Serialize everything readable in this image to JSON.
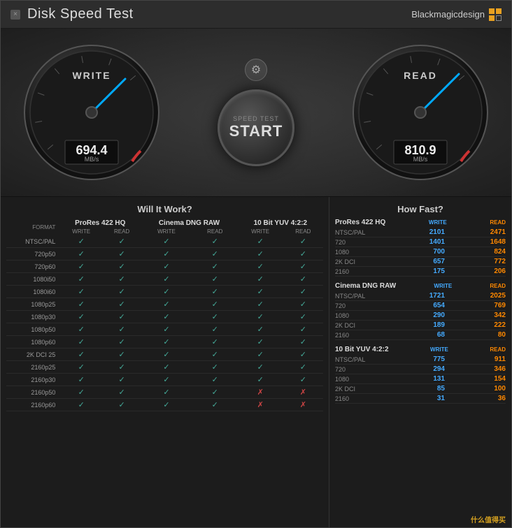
{
  "window": {
    "title": "Disk Speed Test",
    "close_label": "×"
  },
  "brand": {
    "name": "Blackmagicdesign"
  },
  "gauges": {
    "write": {
      "label": "WRITE",
      "value": "694.4",
      "unit": "MB/s"
    },
    "read": {
      "label": "READ",
      "value": "810.9",
      "unit": "MB/s"
    }
  },
  "start_button": {
    "line1": "SPEED TEST",
    "line2": "START"
  },
  "gear_icon": "⚙",
  "will_it_work": {
    "title": "Will It Work?",
    "codecs": [
      "ProRes 422 HQ",
      "Cinema DNG RAW",
      "10 Bit YUV 4:2:2"
    ],
    "col_label": "FORMAT",
    "sub_labels": [
      "WRITE",
      "READ"
    ],
    "rows": [
      {
        "format": "NTSC/PAL",
        "vals": [
          "✓",
          "✓",
          "✓",
          "✓",
          "✓",
          "✓"
        ]
      },
      {
        "format": "720p50",
        "vals": [
          "✓",
          "✓",
          "✓",
          "✓",
          "✓",
          "✓"
        ]
      },
      {
        "format": "720p60",
        "vals": [
          "✓",
          "✓",
          "✓",
          "✓",
          "✓",
          "✓"
        ]
      },
      {
        "format": "1080i50",
        "vals": [
          "✓",
          "✓",
          "✓",
          "✓",
          "✓",
          "✓"
        ]
      },
      {
        "format": "1080i60",
        "vals": [
          "✓",
          "✓",
          "✓",
          "✓",
          "✓",
          "✓"
        ]
      },
      {
        "format": "1080p25",
        "vals": [
          "✓",
          "✓",
          "✓",
          "✓",
          "✓",
          "✓"
        ]
      },
      {
        "format": "1080p30",
        "vals": [
          "✓",
          "✓",
          "✓",
          "✓",
          "✓",
          "✓"
        ]
      },
      {
        "format": "1080p50",
        "vals": [
          "✓",
          "✓",
          "✓",
          "✓",
          "✓",
          "✓"
        ]
      },
      {
        "format": "1080p60",
        "vals": [
          "✓",
          "✓",
          "✓",
          "✓",
          "✓",
          "✓"
        ]
      },
      {
        "format": "2K DCI 25",
        "vals": [
          "✓",
          "✓",
          "✓",
          "✓",
          "✓",
          "✓"
        ]
      },
      {
        "format": "2160p25",
        "vals": [
          "✓",
          "✓",
          "✓",
          "✓",
          "✓",
          "✓"
        ]
      },
      {
        "format": "2160p30",
        "vals": [
          "✓",
          "✓",
          "✓",
          "✓",
          "✓",
          "✓"
        ]
      },
      {
        "format": "2160p50",
        "vals": [
          "✓",
          "✓",
          "✓",
          "✓",
          "✗",
          "✗"
        ]
      },
      {
        "format": "2160p60",
        "vals": [
          "✓",
          "✓",
          "✓",
          "✓",
          "✗",
          "✗"
        ]
      }
    ]
  },
  "how_fast": {
    "title": "How Fast?",
    "sections": [
      {
        "codec": "ProRes 422 HQ",
        "rows": [
          {
            "res": "NTSC/PAL",
            "write": "2101",
            "read": "2471"
          },
          {
            "res": "720",
            "write": "1401",
            "read": "1648"
          },
          {
            "res": "1080",
            "write": "700",
            "read": "824"
          },
          {
            "res": "2K DCI",
            "write": "657",
            "read": "772"
          },
          {
            "res": "2160",
            "write": "175",
            "read": "206"
          }
        ]
      },
      {
        "codec": "Cinema DNG RAW",
        "rows": [
          {
            "res": "NTSC/PAL",
            "write": "1721",
            "read": "2025"
          },
          {
            "res": "720",
            "write": "654",
            "read": "769"
          },
          {
            "res": "1080",
            "write": "290",
            "read": "342"
          },
          {
            "res": "2K DCI",
            "write": "189",
            "read": "222"
          },
          {
            "res": "2160",
            "write": "68",
            "read": "80"
          }
        ]
      },
      {
        "codec": "10 Bit YUV 4:2:2",
        "rows": [
          {
            "res": "NTSC/PAL",
            "write": "775",
            "read": "911"
          },
          {
            "res": "720",
            "write": "294",
            "read": "346"
          },
          {
            "res": "1080",
            "write": "131",
            "read": "154"
          },
          {
            "res": "2K DCI",
            "write": "85",
            "read": "100"
          },
          {
            "res": "2160",
            "write": "31",
            "read": "36"
          }
        ]
      }
    ],
    "write_label": "WRITE",
    "read_label": "READ"
  },
  "watermark": "什么值得买"
}
